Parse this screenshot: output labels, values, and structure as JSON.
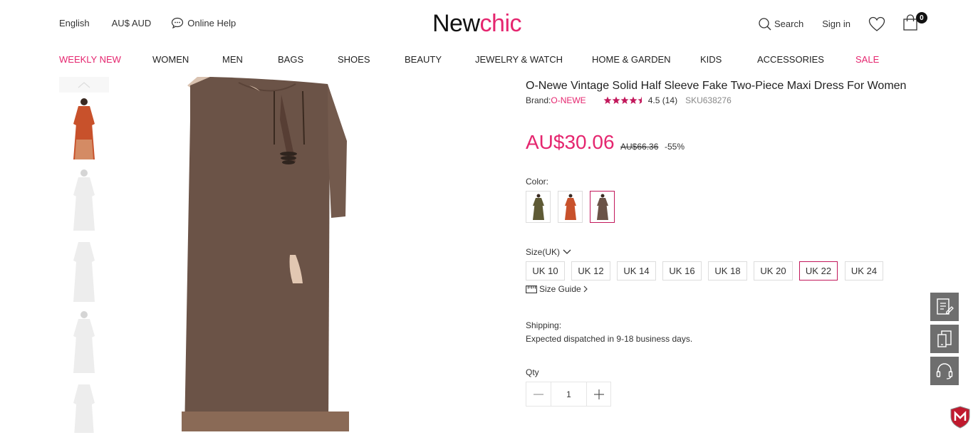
{
  "header": {
    "language": "English",
    "currency": "AU$ AUD",
    "online_help": "Online Help",
    "logo_part1": "New",
    "logo_part2": "chic",
    "search": "Search",
    "sign_in": "Sign in",
    "cart_count": "0"
  },
  "nav": {
    "items": [
      "WEEKLY NEW",
      "WOMEN",
      "MEN",
      "BAGS",
      "SHOES",
      "BEAUTY",
      "JEWELRY & WATCH",
      "HOME & GARDEN",
      "KIDS",
      "ACCESSORIES",
      "SALE"
    ]
  },
  "product": {
    "title": "O-Newe Vintage Solid Half Sleeve Fake Two-Piece Maxi Dress For Women",
    "brand_label": "Brand:",
    "brand_name": "O-NEWE",
    "rating_text": "4.5 (14)",
    "sku": "SKU638276",
    "price": "AU$30.06",
    "old_price": "AU$66.36",
    "discount": "-55%",
    "color_label": "Color:",
    "size_label": "Size(UK)",
    "sizes": [
      "UK 10",
      "UK 12",
      "UK 14",
      "UK 16",
      "UK 18",
      "UK 20",
      "UK 22",
      "UK 24"
    ],
    "selected_size": "UK 22",
    "size_guide": "Size Guide",
    "shipping_label": "Shipping:",
    "shipping_text": "Expected dispatched in 9-18 business days.",
    "qty_label": "Qty",
    "qty_value": "1"
  },
  "colors": {
    "accent": "#e5266f",
    "selected_border": "#c2185b",
    "dress_brown": "#6b5347",
    "dress_orange": "#c8512b",
    "dress_green": "#5e5a35"
  }
}
